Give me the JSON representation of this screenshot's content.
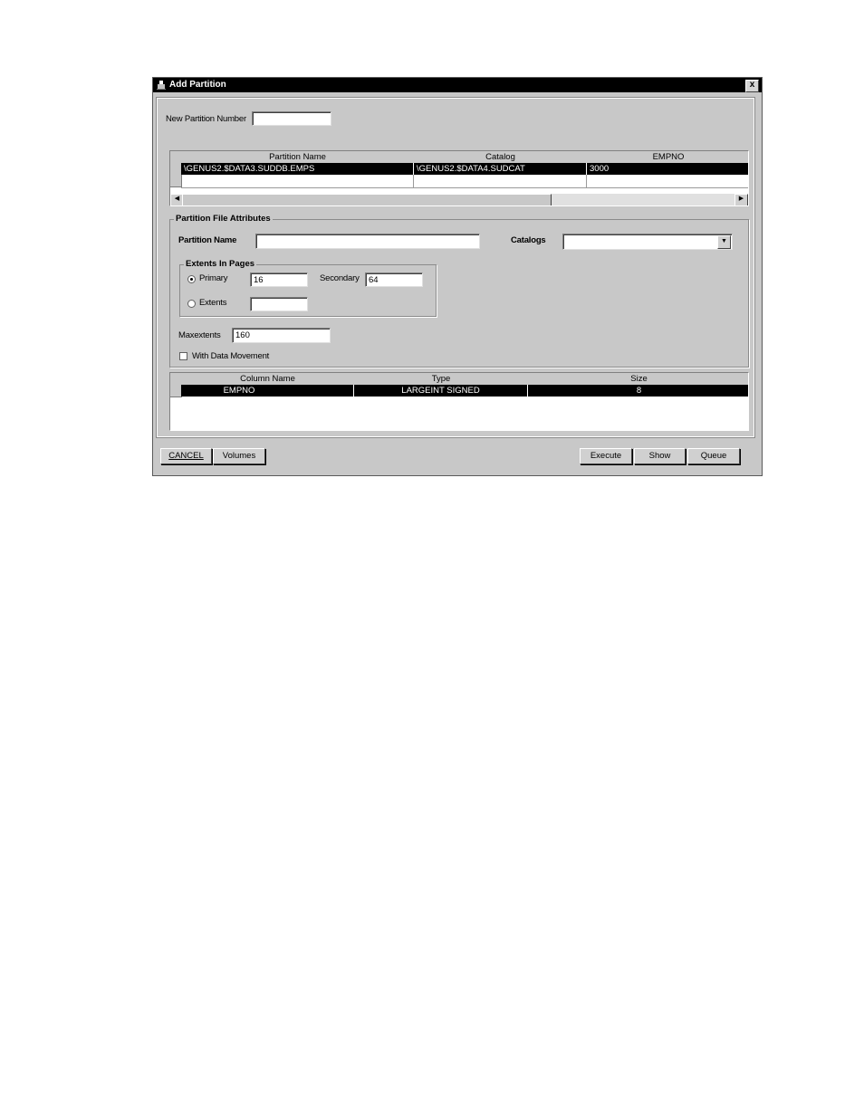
{
  "window": {
    "title": "Add Partition",
    "close_glyph": "x"
  },
  "new_partition": {
    "label": "New Partition Number",
    "value": ""
  },
  "partition_grid": {
    "columns": [
      "Partition Name",
      "Catalog",
      "EMPNO"
    ],
    "rows": [
      [
        "\\GENUS2.$DATA3.SUDDB.EMPS",
        "\\GENUS2.$DATA4.SUDCAT",
        "3000"
      ]
    ]
  },
  "attributes": {
    "group_title": "Partition File Attributes",
    "partition_name_label": "Partition Name",
    "partition_name_value": "",
    "catalogs_label": "Catalogs",
    "catalogs_value": "",
    "extents_group_title": "Extents In Pages",
    "primary_label": "Primary",
    "primary_value": "16",
    "secondary_label": "Secondary",
    "secondary_value": "64",
    "extents_label": "Extents",
    "extents_value": "",
    "maxextents_label": "Maxextents",
    "maxextents_value": "160",
    "with_data_movement_label": "With Data Movement",
    "primary_selected": true,
    "with_data_movement_checked": false
  },
  "column_grid": {
    "columns": [
      "Column Name",
      "Type",
      "Size"
    ],
    "rows": [
      [
        "EMPNO",
        "LARGEINT SIGNED",
        "8"
      ]
    ]
  },
  "buttons": {
    "cancel": "CANCEL",
    "volumes": "Volumes",
    "execute": "Execute",
    "show": "Show",
    "queue": "Queue"
  },
  "icons": {
    "app": "app-icon",
    "close": "close-icon",
    "scroll_left": "scroll-left-icon",
    "scroll_right": "scroll-right-icon",
    "dropdown": "chevron-down-icon"
  }
}
